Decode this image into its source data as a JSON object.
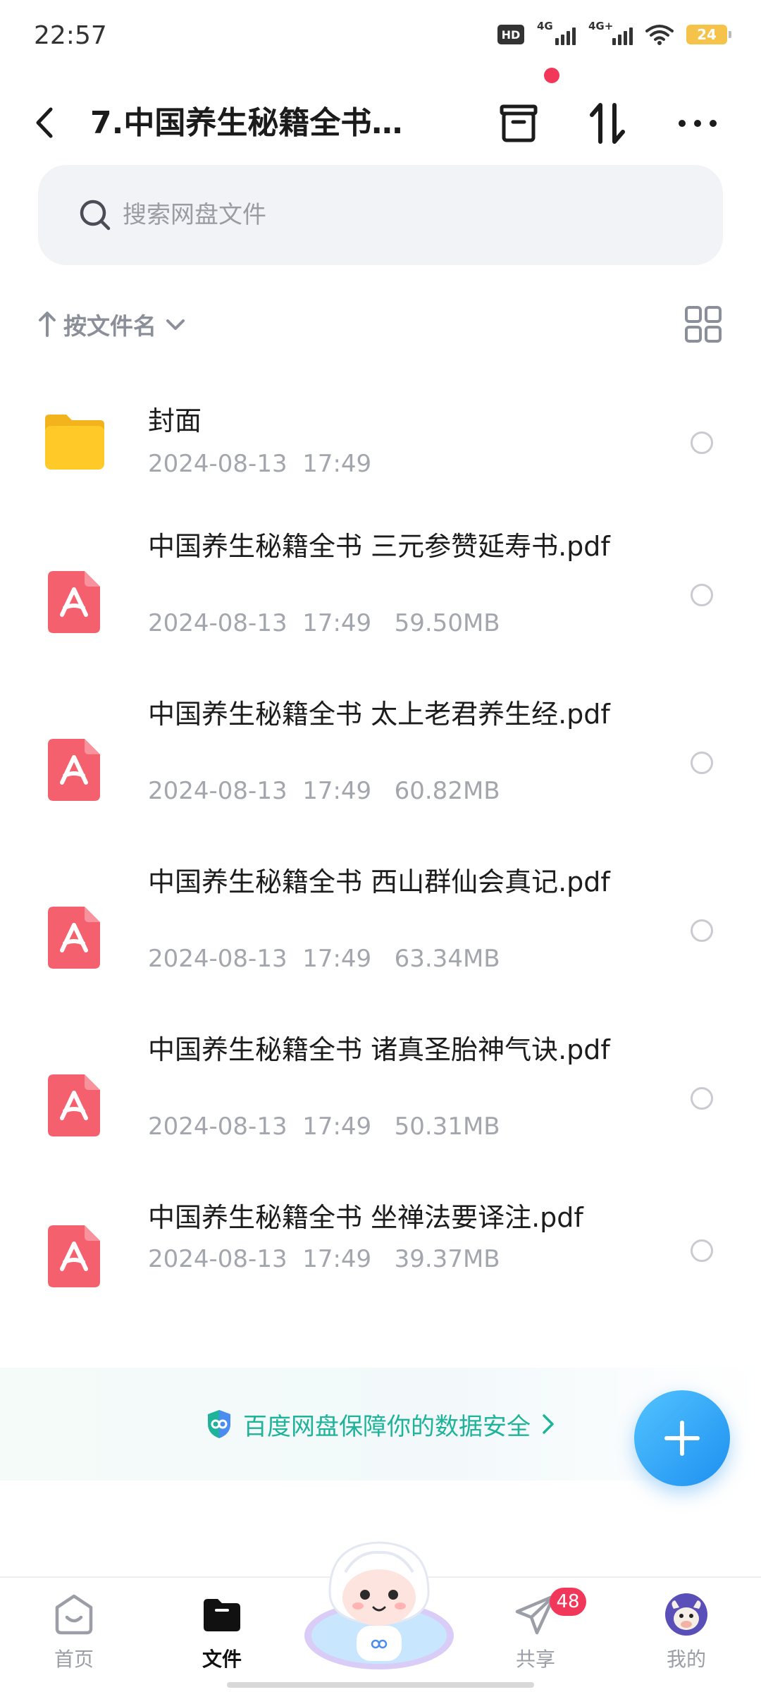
{
  "status_bar": {
    "time": "22:57",
    "hd": "HD",
    "net1": "4G",
    "net2": "4G+",
    "battery": "24"
  },
  "header": {
    "title": "7.中国养生秘籍全书…"
  },
  "search": {
    "placeholder": "搜索网盘文件"
  },
  "sort": {
    "label": "按文件名"
  },
  "files": [
    {
      "name": "封面",
      "meta": "2024-08-13  17:49",
      "type": "folder"
    },
    {
      "name": "中国养生秘籍全书 三元参赞延寿书.pdf",
      "meta": "2024-08-13  17:49   59.50MB",
      "type": "pdf"
    },
    {
      "name": "中国养生秘籍全书 太上老君养生经.pdf",
      "meta": "2024-08-13  17:49   60.82MB",
      "type": "pdf"
    },
    {
      "name": "中国养生秘籍全书 西山群仙会真记.pdf",
      "meta": "2024-08-13  17:49   63.34MB",
      "type": "pdf"
    },
    {
      "name": "中国养生秘籍全书 诸真圣胎神气诀.pdf",
      "meta": "2024-08-13  17:49   50.31MB",
      "type": "pdf"
    },
    {
      "name": "中国养生秘籍全书 坐禅法要译注.pdf",
      "meta": "2024-08-13  17:49   39.37MB",
      "type": "pdf"
    }
  ],
  "banner": {
    "text": "百度网盘保障你的数据安全"
  },
  "nav": {
    "home": "首页",
    "files": "文件",
    "share": "共享",
    "share_badge": "48",
    "mine": "我的"
  },
  "colors": {
    "accent": "#1e90f0",
    "pdf": "#f5606e",
    "folder": "#ffc928",
    "badge": "#f2385a",
    "secure": "#1fb39a"
  }
}
